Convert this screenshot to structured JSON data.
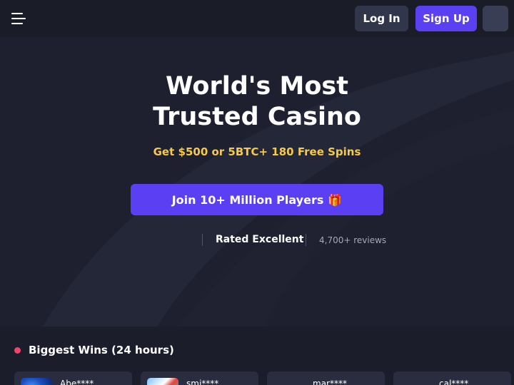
{
  "header": {
    "login_label": "Log In",
    "signup_label": "Sign Up",
    "icons": [
      "menu-icon"
    ]
  },
  "hero": {
    "title_line1": "World's Most",
    "title_line2": "Trusted Casino",
    "offer": "Get $500 or 5BTC+ 180 Free Spins",
    "cta_label": "Join 10+ Million Players",
    "cta_icon": "gift-icon",
    "rating_label": "Rated Excellent",
    "reviews": "4,700+ reviews"
  },
  "wins": {
    "title": "Biggest Wins (24 hours)",
    "items": [
      {
        "user": "Abe****"
      },
      {
        "user": "smi****"
      },
      {
        "user": "mar****"
      },
      {
        "user": "cal****"
      }
    ]
  },
  "colors": {
    "accent": "#5b3ff2",
    "offer": "#f7c948",
    "live": "#f0456b",
    "background": "#1b1d2a"
  }
}
